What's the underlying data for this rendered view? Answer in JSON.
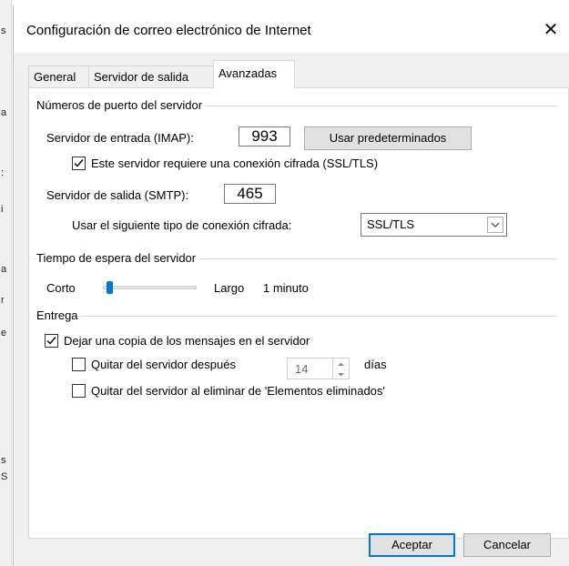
{
  "dialog": {
    "title": "Configuración de correo electrónico de Internet",
    "close_glyph": "✕"
  },
  "tabs": [
    {
      "label": "General",
      "active": false
    },
    {
      "label": "Servidor de salida",
      "active": false
    },
    {
      "label": "Avanzadas",
      "active": true
    }
  ],
  "ports": {
    "group_title": "Números de puerto del servidor",
    "incoming_label": "Servidor de entrada (IMAP):",
    "incoming_value": "993",
    "defaults_button": "Usar predeterminados",
    "ssl_checkbox_label": "Este servidor requiere una conexión cifrada (SSL/TLS)",
    "ssl_checked": true,
    "outgoing_label": "Servidor de salida (SMTP):",
    "outgoing_value": "465",
    "encryption_label": "Usar el siguiente tipo de conexión cifrada:",
    "encryption_value": "SSL/TLS"
  },
  "timeout": {
    "group_title": "Tiempo de espera del servidor",
    "short_label": "Corto",
    "long_label": "Largo",
    "value_label": "1 minuto",
    "slider_fraction": 0.04
  },
  "delivery": {
    "group_title": "Entrega",
    "leave_copy_label": "Dejar una copia de los mensajes en el servidor",
    "leave_copy_checked": true,
    "remove_after_label": "Quitar del servidor después",
    "remove_after_checked": false,
    "days_value": "14",
    "days_label": "días",
    "remove_deleted_label": "Quitar del servidor al eliminar de 'Elementos eliminados'",
    "remove_deleted_checked": false
  },
  "footer": {
    "ok_button": "Aceptar",
    "cancel_button": "Cancelar"
  },
  "background_fragments": [
    "s",
    "a",
    ":",
    "i",
    "a",
    "r",
    "e",
    "s",
    "S"
  ]
}
